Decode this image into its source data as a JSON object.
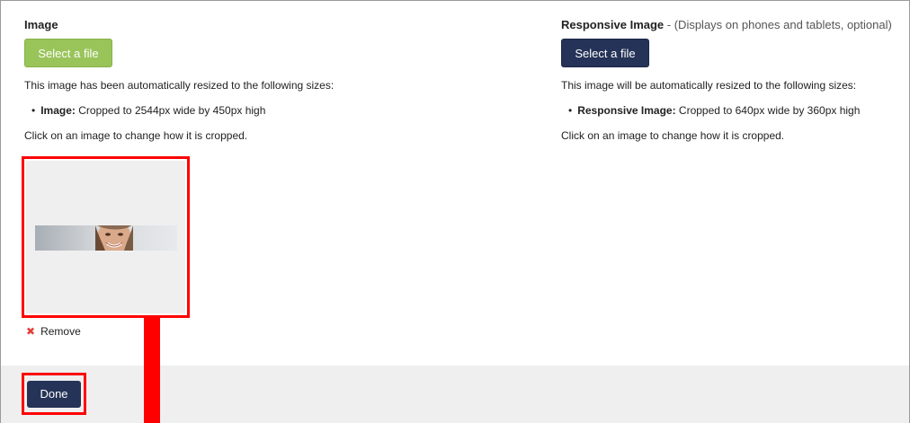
{
  "left": {
    "title": "Image",
    "button_label": "Select a file",
    "info": "This image has been automatically resized to the following sizes:",
    "sizes": [
      {
        "label": "Image:",
        "text": "Cropped to 2544px wide by 450px high"
      }
    ],
    "crop_hint": "Click on an image to change how it is cropped.",
    "remove_label": "Remove"
  },
  "right": {
    "title": "Responsive Image",
    "subtitle": "- (Displays on phones and tablets, optional)",
    "button_label": "Select a file",
    "info": "This image will be automatically resized to the following sizes:",
    "sizes": [
      {
        "label": "Responsive Image:",
        "text": "Cropped to 640px wide by 360px high"
      }
    ],
    "crop_hint": "Click on an image to change how it is cropped."
  },
  "footer": {
    "done_label": "Done"
  },
  "colors": {
    "select_green": "#99c45a",
    "navy": "#253358",
    "highlight_red": "#ff0000",
    "remove_red": "#e0413a"
  },
  "icons": {
    "remove": "close-x-icon",
    "bullet": "bullet-icon"
  }
}
